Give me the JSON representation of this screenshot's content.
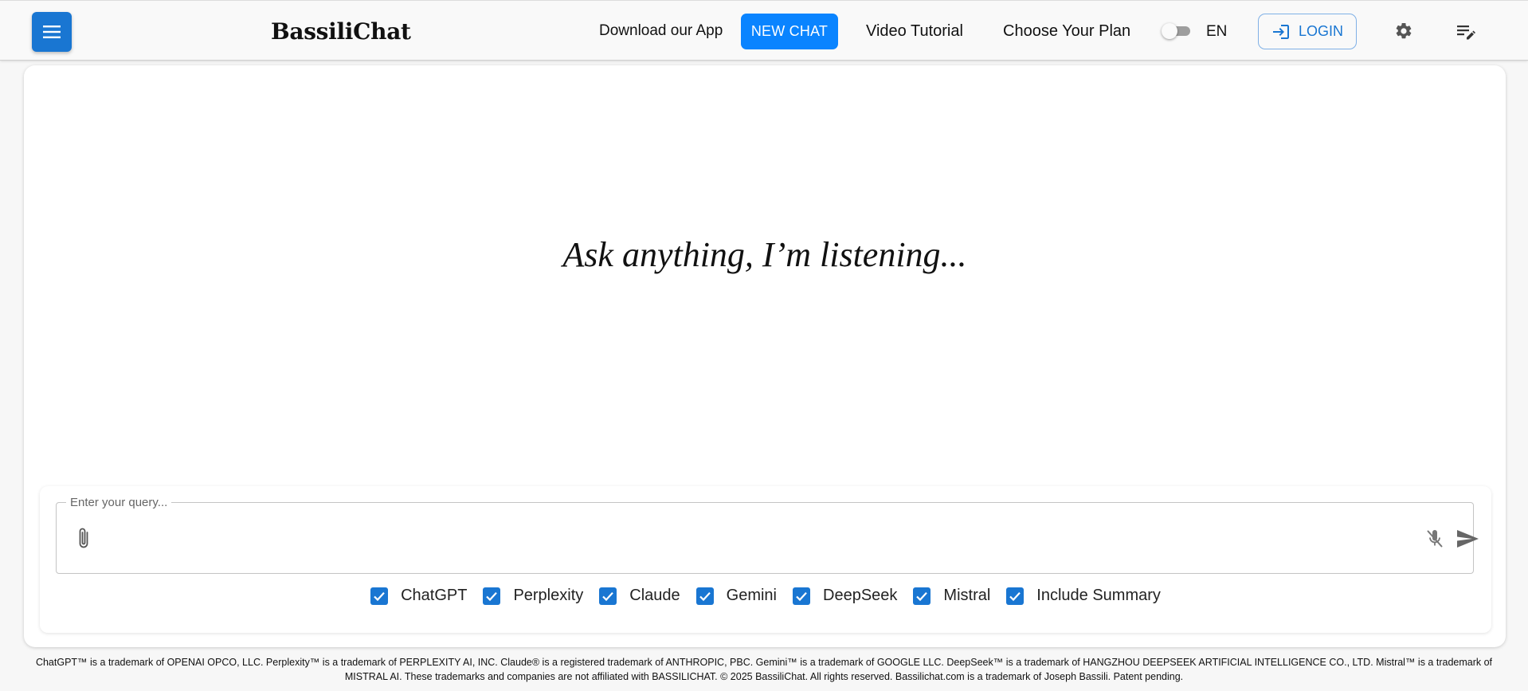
{
  "header": {
    "brand": "BassiliChat",
    "download_label": "Download our App",
    "new_chat_label": "NEW CHAT",
    "video_tutorial_label": "Video Tutorial",
    "choose_plan_label": "Choose Your Plan",
    "language": "EN",
    "login_label": "LOGIN",
    "icons": {
      "menu": "menu-icon",
      "login": "login-icon",
      "settings": "gear-icon",
      "notes": "playlist-edit-icon"
    }
  },
  "main": {
    "prompt": "Ask anything, I’m listening...",
    "query": {
      "placeholder": "Enter your query...",
      "value": ""
    },
    "models": [
      {
        "label": "ChatGPT",
        "checked": true
      },
      {
        "label": "Perplexity",
        "checked": true
      },
      {
        "label": "Claude",
        "checked": true
      },
      {
        "label": "Gemini",
        "checked": true
      },
      {
        "label": "DeepSeek",
        "checked": true
      },
      {
        "label": "Mistral",
        "checked": true
      },
      {
        "label": "Include Summary",
        "checked": true
      }
    ]
  },
  "footer": {
    "text": "ChatGPT™ is a trademark of OPENAI OPCO, LLC. Perplexity™ is a trademark of PERPLEXITY AI, INC. Claude® is a registered trademark of ANTHROPIC, PBC. Gemini™ is a trademark of GOOGLE LLC. DeepSeek™ is a trademark of HANGZHOU DEEPSEEK ARTIFICIAL INTELLIGENCE CO., LTD. Mistral™ is a trademark of MISTRAL AI. These trademarks and companies are not affiliated with BASSILICHAT. © 2025 BassiliChat. All rights reserved. Bassilichat.com is a trademark of Joseph Bassili. Patent pending."
  },
  "colors": {
    "primary": "#1976d2",
    "new_chat": "#0a84ff",
    "background": "#f7f7f7"
  }
}
